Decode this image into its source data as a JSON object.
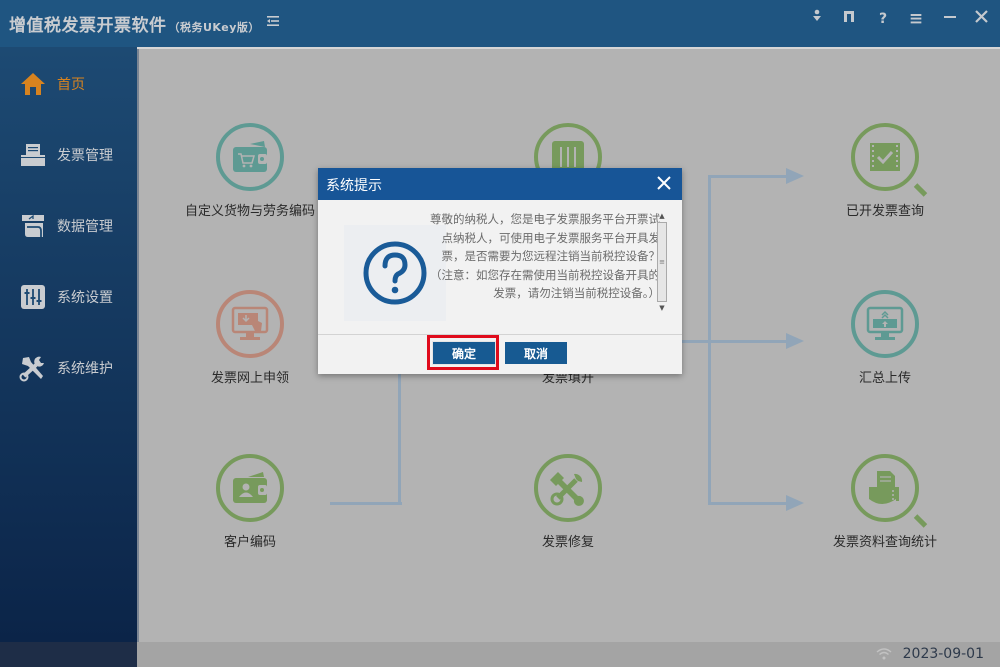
{
  "app": {
    "title": "增值税发票开票软件",
    "subtitle": "（税务UKey版）",
    "collapse_icon": "menu-collapse-icon",
    "window_controls": [
      {
        "name": "download",
        "glyph": "⬇"
      },
      {
        "name": "bookmark",
        "glyph": "◧"
      },
      {
        "name": "help",
        "glyph": "?"
      },
      {
        "name": "menu",
        "glyph": "≡"
      },
      {
        "name": "minimize",
        "glyph": "—"
      },
      {
        "name": "close",
        "glyph": "✕"
      }
    ]
  },
  "sidebar": {
    "items": [
      {
        "label": "首页",
        "icon": "home-icon",
        "active": true
      },
      {
        "label": "发票管理",
        "icon": "printer-icon",
        "active": false
      },
      {
        "label": "数据管理",
        "icon": "data-icon",
        "active": false
      },
      {
        "label": "系统设置",
        "icon": "sliders-icon",
        "active": false
      },
      {
        "label": "系统维护",
        "icon": "tools-icon",
        "active": false
      }
    ]
  },
  "features": {
    "custom_goods": {
      "label": "自定义货物与劳务编码",
      "color": "#5e9a93"
    },
    "online_apply": {
      "label": "发票网上申领",
      "color": "#b98677"
    },
    "customer_code": {
      "label": "客户编码",
      "color": "#779a5c"
    },
    "settings": {
      "label": "",
      "color": "#779a5c"
    },
    "invoice_fill": {
      "label": "发票填开",
      "color": "#779a5c"
    },
    "invoice_repair": {
      "label": "发票修复",
      "color": "#779a5c"
    },
    "issued_query": {
      "label": "已开发票查询",
      "color": "#779a5c"
    },
    "summary_upload": {
      "label": "汇总上传",
      "color": "#5e9a93"
    },
    "data_stats": {
      "label": "发票资料查询统计",
      "color": "#779a5c"
    }
  },
  "dialog": {
    "title": "系统提示",
    "message": "尊敬的纳税人，您是电子发票服务平台开票试点纳税人，可使用电子发票服务平台开具发票，是否需要为您远程注销当前税控设备？（注意：如您存在需使用当前税控设备开具的发票，请勿注销当前税控设备。）",
    "ok_label": "确定",
    "cancel_label": "取消"
  },
  "status": {
    "date": "2023-09-01",
    "network_icon": "wifi-icon"
  }
}
